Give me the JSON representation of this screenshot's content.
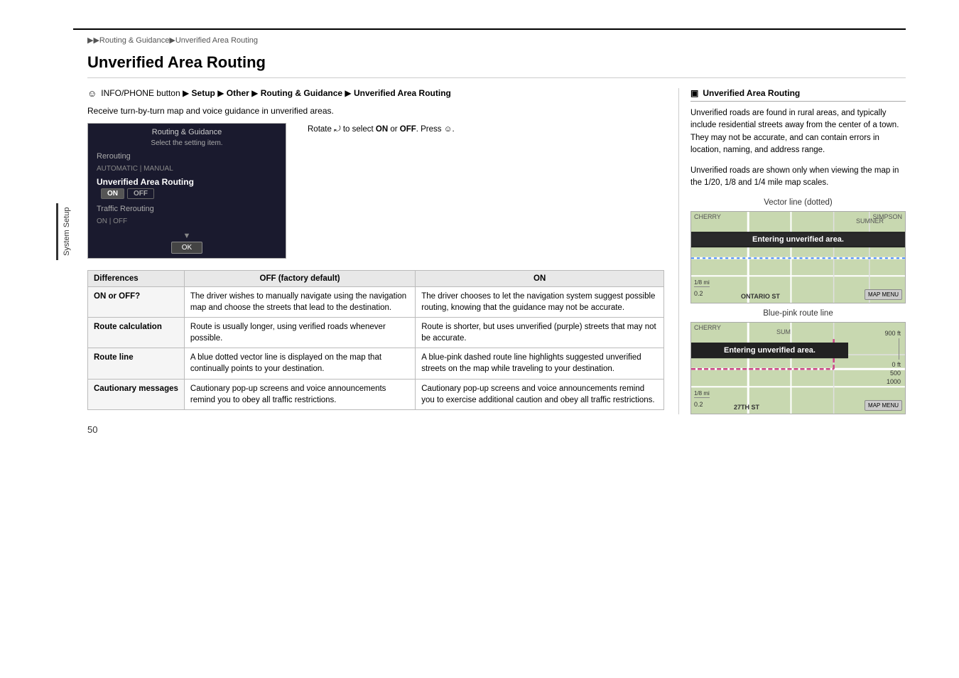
{
  "breadcrumb": "▶▶Routing & Guidance▶Unverified Area Routing",
  "page_title": "Unverified Area Routing",
  "instruction": {
    "icon": "☺",
    "path": "INFO/PHONE button ▶ Setup ▶ Other ▶ Routing & Guidance ▶ Unverified Area Routing"
  },
  "description": "Receive turn-by-turn map and voice guidance in unverified areas.",
  "screen": {
    "title": "Routing & Guidance",
    "subtitle": "Select the setting item.",
    "items": [
      "Rerouting",
      "AUTOMATIC | MANUAL",
      "Unverified Area Routing",
      "ON | OFF",
      "Traffic Rerouting",
      "ON | OFF"
    ],
    "ok_label": "OK"
  },
  "rotate_text": "Rotate ⤾ to select ON or OFF. Press ☺.",
  "table": {
    "headers": [
      "Differences",
      "OFF (factory default)",
      "ON"
    ],
    "rows": [
      {
        "label": "ON or OFF?",
        "off": "The driver wishes to manually navigate using the navigation map and choose the streets that lead to the destination.",
        "on": "The driver chooses to let the navigation system suggest possible routing, knowing that the guidance may not be accurate."
      },
      {
        "label": "Route calculation",
        "off": "Route is usually longer, using verified roads whenever possible.",
        "on": "Route is shorter, but uses unverified (purple) streets that may not be accurate."
      },
      {
        "label": "Route line",
        "off": "A blue dotted vector line is displayed on the map that continually points to your destination.",
        "on": "A blue-pink dashed route line highlights suggested unverified streets on the map while traveling to your destination."
      },
      {
        "label": "Cautionary messages",
        "off": "Cautionary pop-up screens and voice announcements remind you to obey all traffic restrictions.",
        "on": "Cautionary pop-up screens and voice announcements remind you to exercise additional caution and obey all traffic restrictions."
      }
    ]
  },
  "right_panel": {
    "section_title": "Unverified Area Routing",
    "text1": "Unverified roads are found in rural areas, and typically include residential streets away from the center of a town. They may not be accurate, and can contain errors in location, naming, and address range.",
    "text2": "Unverified roads are shown only when viewing the map in the 1/20, 1/8 and 1/4 mile map scales.",
    "vector_line_label": "Vector line (dotted)",
    "map1_banner": "Entering unverified area.",
    "map1_streets": [
      "CHERRY",
      "SUMNER",
      "SIMPSON",
      "ONTARIO ST",
      "MAP MENU"
    ],
    "blue_pink_label": "Blue-pink route line",
    "map2_banner": "Entering unverified area.",
    "map2_streets": [
      "CHERRY",
      "SUM",
      "900 ft",
      "0 ft",
      "500",
      "1000",
      "27TH ST",
      "MAP MENU"
    ]
  },
  "sidebar_label": "System Setup",
  "page_number": "50"
}
